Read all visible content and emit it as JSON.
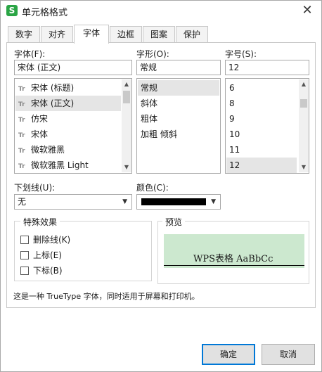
{
  "window": {
    "title": "单元格格式",
    "app_icon_glyph": "S",
    "app_icon_color": "#2aa545",
    "close_glyph": "✕"
  },
  "tabs": [
    {
      "label": "数字",
      "active": false
    },
    {
      "label": "对齐",
      "active": false
    },
    {
      "label": "字体",
      "active": true
    },
    {
      "label": "边框",
      "active": false
    },
    {
      "label": "图案",
      "active": false
    },
    {
      "label": "保护",
      "active": false
    }
  ],
  "font": {
    "label": "字体(F):",
    "value": "宋体 (正文)",
    "items": [
      {
        "label": "宋体 (标题)",
        "selected": false
      },
      {
        "label": "宋体 (正文)",
        "selected": true
      },
      {
        "label": "仿宋",
        "selected": false
      },
      {
        "label": "宋体",
        "selected": false
      },
      {
        "label": "微软雅黑",
        "selected": false
      },
      {
        "label": "微软雅黑 Light",
        "selected": false
      }
    ]
  },
  "style": {
    "label": "字形(O):",
    "value": "常规",
    "items": [
      {
        "label": "常规",
        "selected": true
      },
      {
        "label": "斜体",
        "selected": false
      },
      {
        "label": "粗体",
        "selected": false
      },
      {
        "label": "加粗 倾斜",
        "selected": false
      }
    ]
  },
  "size": {
    "label": "字号(S):",
    "value": "12",
    "items": [
      {
        "label": "6",
        "selected": false
      },
      {
        "label": "8",
        "selected": false
      },
      {
        "label": "9",
        "selected": false
      },
      {
        "label": "10",
        "selected": false
      },
      {
        "label": "11",
        "selected": false
      },
      {
        "label": "12",
        "selected": true
      }
    ]
  },
  "underline": {
    "label": "下划线(U):",
    "value": "无"
  },
  "color": {
    "label": "颜色(C):",
    "value_hex": "#000000"
  },
  "effects": {
    "title": "特殊效果",
    "items": [
      {
        "label": "删除线(K)",
        "checked": false
      },
      {
        "label": "上标(E)",
        "checked": false
      },
      {
        "label": "下标(B)",
        "checked": false
      }
    ]
  },
  "preview": {
    "title": "预览",
    "text": "WPS表格  AaBbCc",
    "background": "#cce8cf"
  },
  "description": "这是一种 TrueType 字体，同时适用于屏幕和打印机。",
  "buttons": {
    "ok": "确定",
    "cancel": "取消"
  }
}
